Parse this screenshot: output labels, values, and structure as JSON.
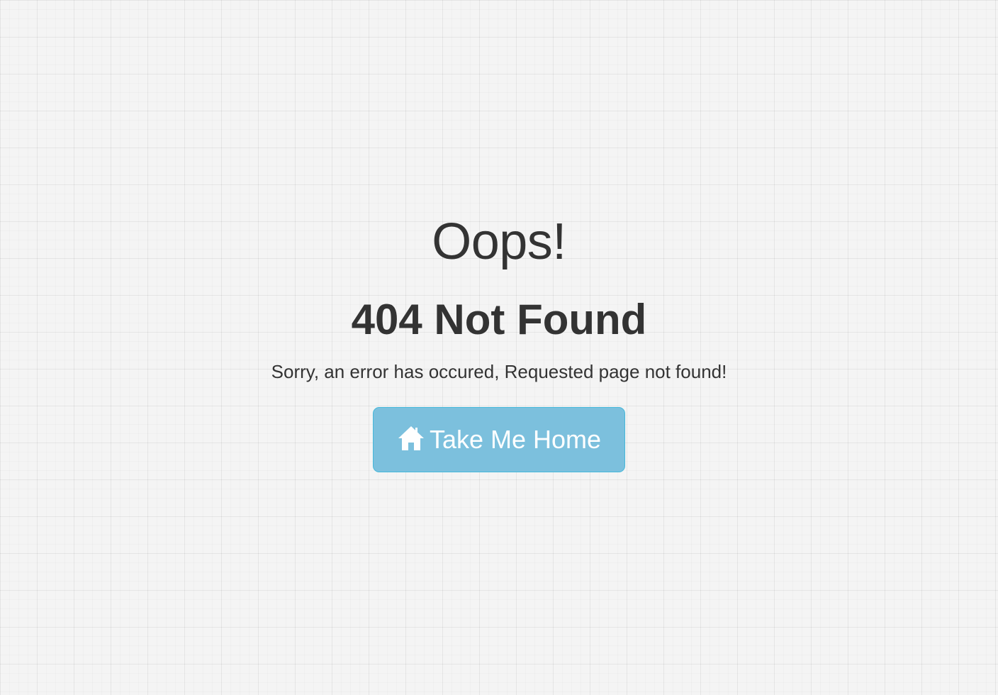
{
  "error": {
    "title": "Oops!",
    "code": "404 Not Found",
    "message": "Sorry, an error has occured, Requested page not found!"
  },
  "home_button": {
    "label": "Take Me Home",
    "icon": "home-icon"
  },
  "colors": {
    "button_background": "#7cc0dd",
    "button_border": "#46b8da",
    "text": "#333333",
    "page_background": "#f4f4f4"
  }
}
